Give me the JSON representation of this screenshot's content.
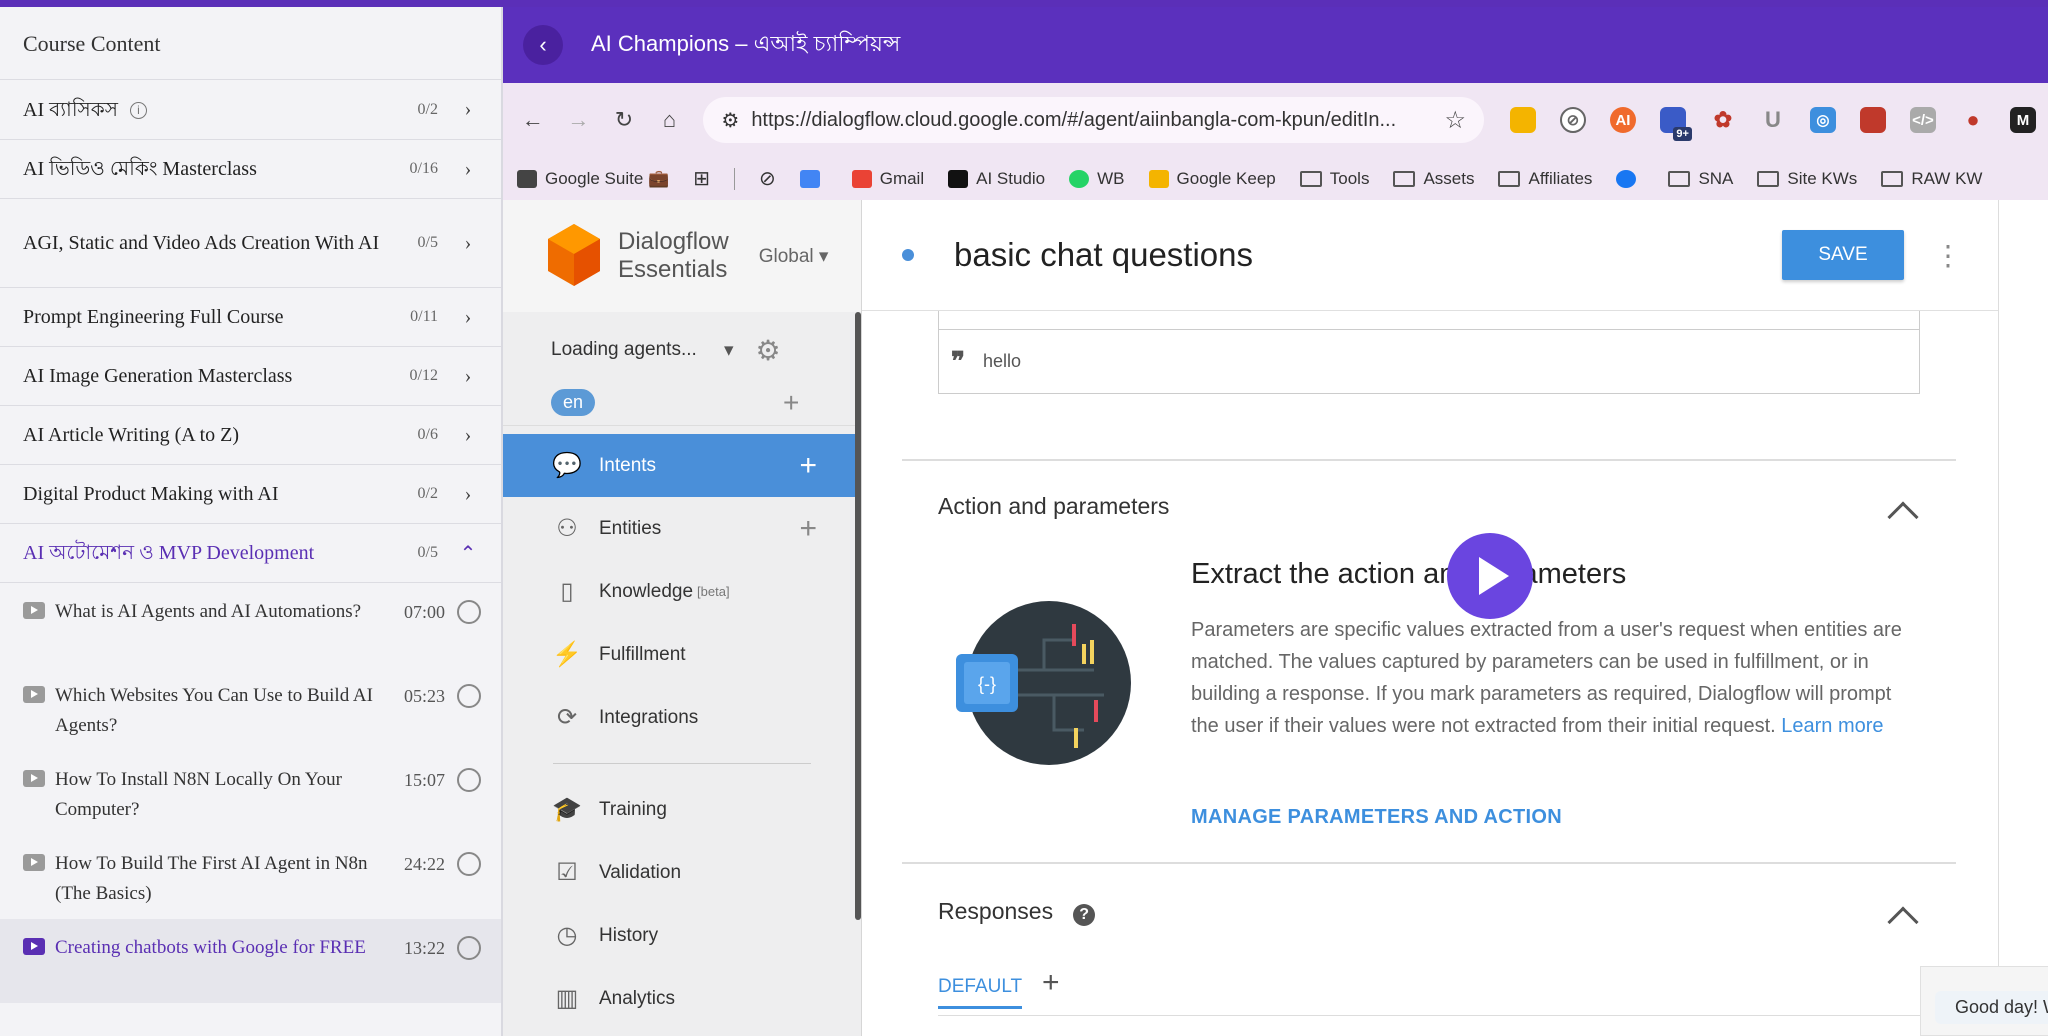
{
  "sidebar": {
    "title": "Course Content",
    "sections": [
      {
        "title": "AI ব্যাসিকস",
        "count": "0/2"
      },
      {
        "title": "AI ভিডিও মেকিং Masterclass",
        "count": "0/16"
      },
      {
        "title": "AGI, Static and Video Ads Creation With AI",
        "count": "0/5"
      },
      {
        "title": "Prompt Engineering Full Course",
        "count": "0/11"
      },
      {
        "title": "AI Image Generation Masterclass",
        "count": "0/12"
      },
      {
        "title": "AI Article Writing (A to Z)",
        "count": "0/6"
      },
      {
        "title": "Digital Product Making with AI",
        "count": "0/2"
      },
      {
        "title": "AI অটোমেশন ও MVP Development",
        "count": "0/5"
      }
    ],
    "lessons": [
      {
        "title": "What is AI Agents and AI Automations?",
        "duration": "07:00"
      },
      {
        "title": "Which Websites You Can Use to Build AI Agents?",
        "duration": "05:23"
      },
      {
        "title": "How To Install N8N Locally On Your Computer?",
        "duration": "15:07"
      },
      {
        "title": "How To Build The First AI Agent in N8n (The Basics)",
        "duration": "24:22"
      },
      {
        "title": "Creating chatbots with Google for FREE",
        "duration": "13:22"
      }
    ]
  },
  "header": {
    "title": "AI Champions – এআই চ্যাম্পিয়ন্স"
  },
  "browser": {
    "url": "https://dialogflow.cloud.google.com/#/agent/aiinbangla-com-kpun/editIn...",
    "bookmarks": [
      "Google Suite 💼",
      "Gmail",
      "AI Studio",
      "WB",
      "Google Keep",
      "Tools",
      "Assets",
      "Affiliates",
      "SNA",
      "Site KWs",
      "RAW KW"
    ],
    "ext_badge": "9+"
  },
  "dialogflow": {
    "brand_line1": "Dialogflow",
    "brand_line2": "Essentials",
    "region": "Global",
    "agent": "Loading agents...",
    "lang": "en",
    "nav": [
      "Intents",
      "Entities",
      "Knowledge",
      "Fulfillment",
      "Integrations",
      "Training",
      "Validation",
      "History",
      "Analytics"
    ],
    "knowledge_tag": "[beta]"
  },
  "intent": {
    "name": "basic chat questions",
    "save": "SAVE",
    "phrase": "hello",
    "action_heading": "Action and parameters",
    "extract_title": "Extract the action and parameters",
    "extract_desc": "Parameters are specific values extracted from a user's request when entities are matched. The values captured by parameters can be used in fulfillment, or in building a response. If you mark parameters as required, Dialogflow will prompt the user if their values were not extracted from their initial request.",
    "learn_more": "Learn more",
    "manage": "MANAGE PARAMETERS AND ACTION",
    "responses_heading": "Responses",
    "tab_default": "DEFAULT"
  },
  "chat_preview": "Good day! W",
  "colors": {
    "accent_purple": "#5b30bd",
    "dialogflow_blue": "#4a8fd9"
  }
}
